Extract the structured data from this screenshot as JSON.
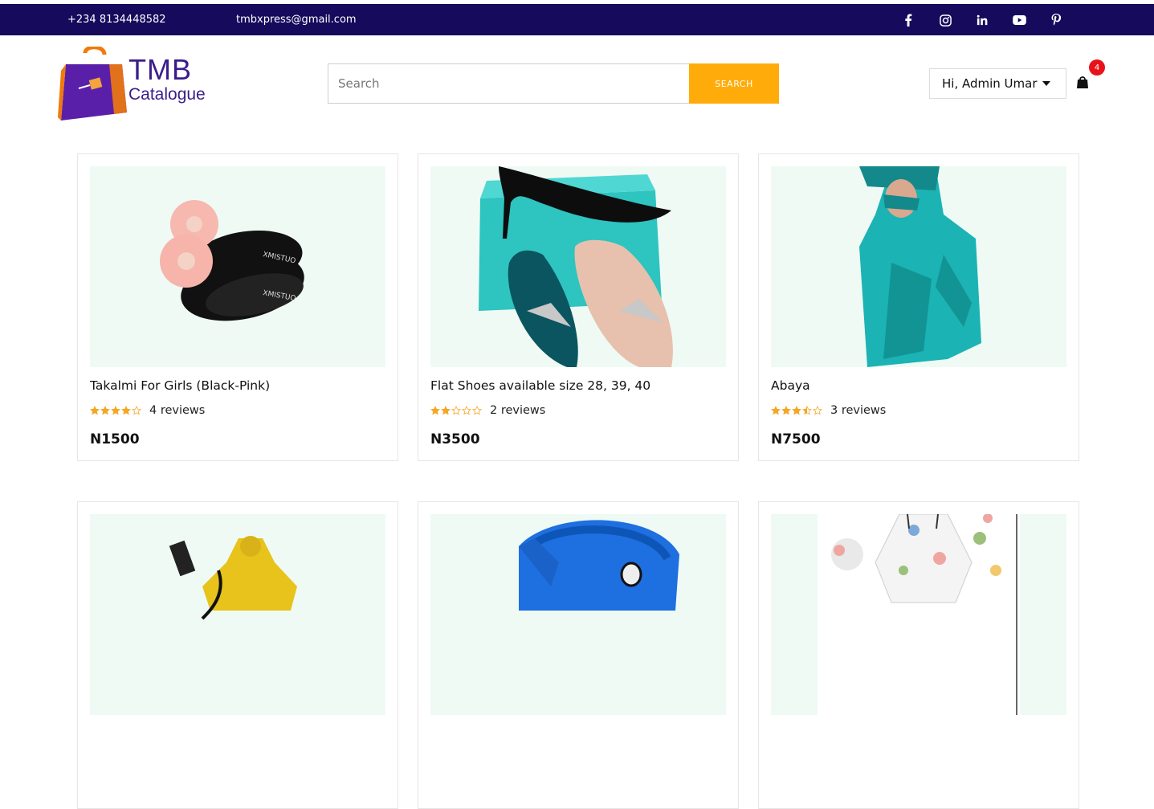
{
  "topbar": {
    "phone": "+234 8134448582",
    "email": "tmbxpress@gmail.com",
    "socials": [
      "facebook-icon",
      "instagram-icon",
      "linkedin-icon",
      "youtube-icon",
      "pinterest-icon"
    ]
  },
  "logo": {
    "brand": "TMB",
    "sub": "Catalogue"
  },
  "search": {
    "placeholder": "Search",
    "button": "SEARCH"
  },
  "user": {
    "greeting": "Hi, Admin Umar"
  },
  "cart": {
    "count": "4"
  },
  "colors": {
    "topbar": "#150a5c",
    "accent": "#ffac0a",
    "badge": "#e8131a",
    "star": "#f5a623"
  },
  "products": [
    {
      "title": "Takalmi For Girls (Black-Pink)",
      "rating": 4,
      "reviews": "4 reviews",
      "price": "N1500"
    },
    {
      "title": "Flat Shoes available size 28, 39, 40",
      "rating": 2,
      "reviews": "2 reviews",
      "price": "N3500"
    },
    {
      "title": "Abaya",
      "rating": 3.5,
      "reviews": "3 reviews",
      "price": "N7500"
    },
    {
      "title": "",
      "rating": 0,
      "reviews": "",
      "price": ""
    },
    {
      "title": "",
      "rating": 0,
      "reviews": "",
      "price": ""
    },
    {
      "title": "",
      "rating": 0,
      "reviews": "",
      "price": ""
    }
  ]
}
